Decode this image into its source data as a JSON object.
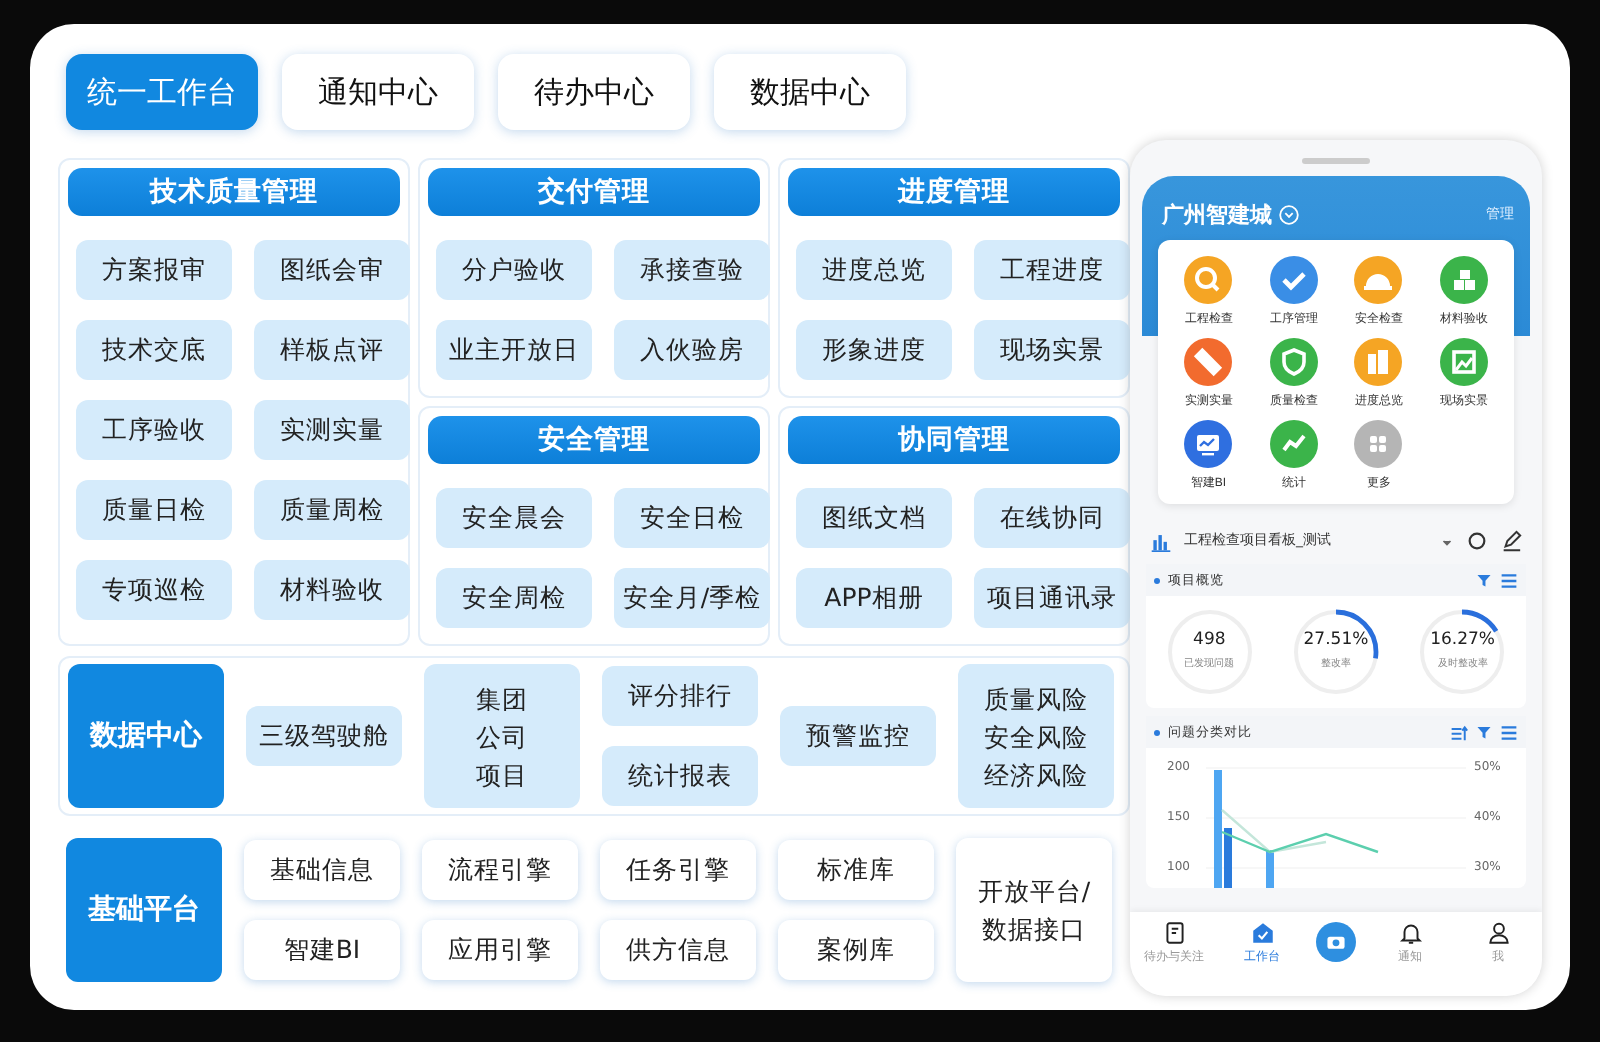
{
  "tabs": [
    {
      "label": "统一工作台",
      "selected": true
    },
    {
      "label": "通知中心",
      "selected": false
    },
    {
      "label": "待办中心",
      "selected": false
    },
    {
      "label": "数据中心",
      "selected": false
    }
  ],
  "columns": [
    [
      {
        "title": "技术质量管理",
        "buttons": [
          "方案报审",
          "图纸会审",
          "技术交底",
          "样板点评",
          "工序验收",
          "实测实量",
          "质量日检",
          "质量周检",
          "专项巡检",
          "材料验收"
        ]
      }
    ],
    [
      {
        "title": "交付管理",
        "buttons": [
          "分户验收",
          "承接查验",
          "业主开放日",
          "入伙验房"
        ]
      },
      {
        "title": "安全管理",
        "buttons": [
          "安全晨会",
          "安全日检",
          "安全周检",
          "安全月/季检"
        ]
      }
    ],
    [
      {
        "title": "进度管理",
        "buttons": [
          "进度总览",
          "工程进度",
          "形象进度",
          "现场实景"
        ]
      },
      {
        "title": "协同管理",
        "buttons": [
          "图纸文档",
          "在线协同",
          "APP相册",
          "项目通讯录"
        ]
      }
    ]
  ],
  "data_center": {
    "title": "数据中心",
    "items": [
      {
        "kind": "single",
        "labels": [
          "三级驾驶舱"
        ]
      },
      {
        "kind": "stack",
        "labels": [
          "集团",
          "公司",
          "项目"
        ]
      },
      {
        "kind": "pair",
        "labels": [
          "评分排行",
          "统计报表"
        ]
      },
      {
        "kind": "single",
        "labels": [
          "预警监控"
        ]
      },
      {
        "kind": "stack",
        "labels": [
          "质量风险",
          "安全风险",
          "经济风险"
        ]
      }
    ]
  },
  "platform": {
    "title": "基础平台",
    "items": [
      {
        "kind": "pair",
        "labels": [
          "基础信息",
          "智建BI"
        ]
      },
      {
        "kind": "pair",
        "labels": [
          "流程引擎",
          "应用引擎"
        ]
      },
      {
        "kind": "pair",
        "labels": [
          "任务引擎",
          "供方信息"
        ]
      },
      {
        "kind": "pair",
        "labels": [
          "标准库",
          "案例库"
        ]
      },
      {
        "kind": "stack",
        "labels": [
          "开放平台/",
          "数据接口"
        ]
      }
    ]
  },
  "phone": {
    "city": "广州智建城",
    "manage": "管理",
    "apps": [
      {
        "label": "工程检查",
        "color": "#f5a524",
        "kind": "search"
      },
      {
        "label": "工序管理",
        "color": "#3a8ee6",
        "kind": "check"
      },
      {
        "label": "安全检查",
        "color": "#f5a524",
        "kind": "helmet"
      },
      {
        "label": "材料验收",
        "color": "#3bb44a",
        "kind": "boxes"
      },
      {
        "label": "实测实量",
        "color": "#f26b2e",
        "kind": "ruler"
      },
      {
        "label": "质量检查",
        "color": "#3bb44a",
        "kind": "shield"
      },
      {
        "label": "进度总览",
        "color": "#f5a524",
        "kind": "building"
      },
      {
        "label": "现场实景",
        "color": "#3bb44a",
        "kind": "image"
      },
      {
        "label": "智建BI",
        "color": "#2f6fe0",
        "kind": "monitor"
      },
      {
        "label": "统计",
        "color": "#3bb44a",
        "kind": "trend"
      },
      {
        "label": "更多",
        "color": "#b5b5b5",
        "kind": "grid"
      }
    ],
    "board_title": "工程检查项目看板_测试",
    "overview": {
      "title": "项目概览",
      "stats": [
        {
          "value": "498",
          "label": "已发现问题"
        },
        {
          "value": "27.51%",
          "label": "整改率",
          "level": 0.2751
        },
        {
          "value": "16.27%",
          "label": "及时整改率",
          "level": 0.1627
        }
      ]
    },
    "compare": {
      "title": "问题分类对比",
      "left_axis_labels": [
        "200",
        "150",
        "100"
      ],
      "right_axis_labels": [
        "50%",
        "40%",
        "30%"
      ]
    },
    "nav": [
      {
        "kind": "doc",
        "label": "待办与关注",
        "selected": false
      },
      {
        "kind": "home",
        "label": "工作台",
        "selected": true
      },
      {
        "kind": "camera",
        "selected": false
      },
      {
        "kind": "bell",
        "label": "通知",
        "selected": false
      },
      {
        "kind": "person",
        "label": "我",
        "selected": false
      }
    ]
  }
}
